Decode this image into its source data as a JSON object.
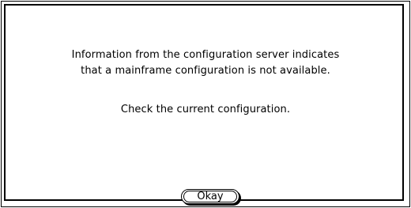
{
  "dialog": {
    "message_lines": [
      "Information from the configuration server indicates",
      "that a mainframe configuration is not available."
    ],
    "instruction": "Check the current configuration.",
    "okay_label": "Okay"
  }
}
